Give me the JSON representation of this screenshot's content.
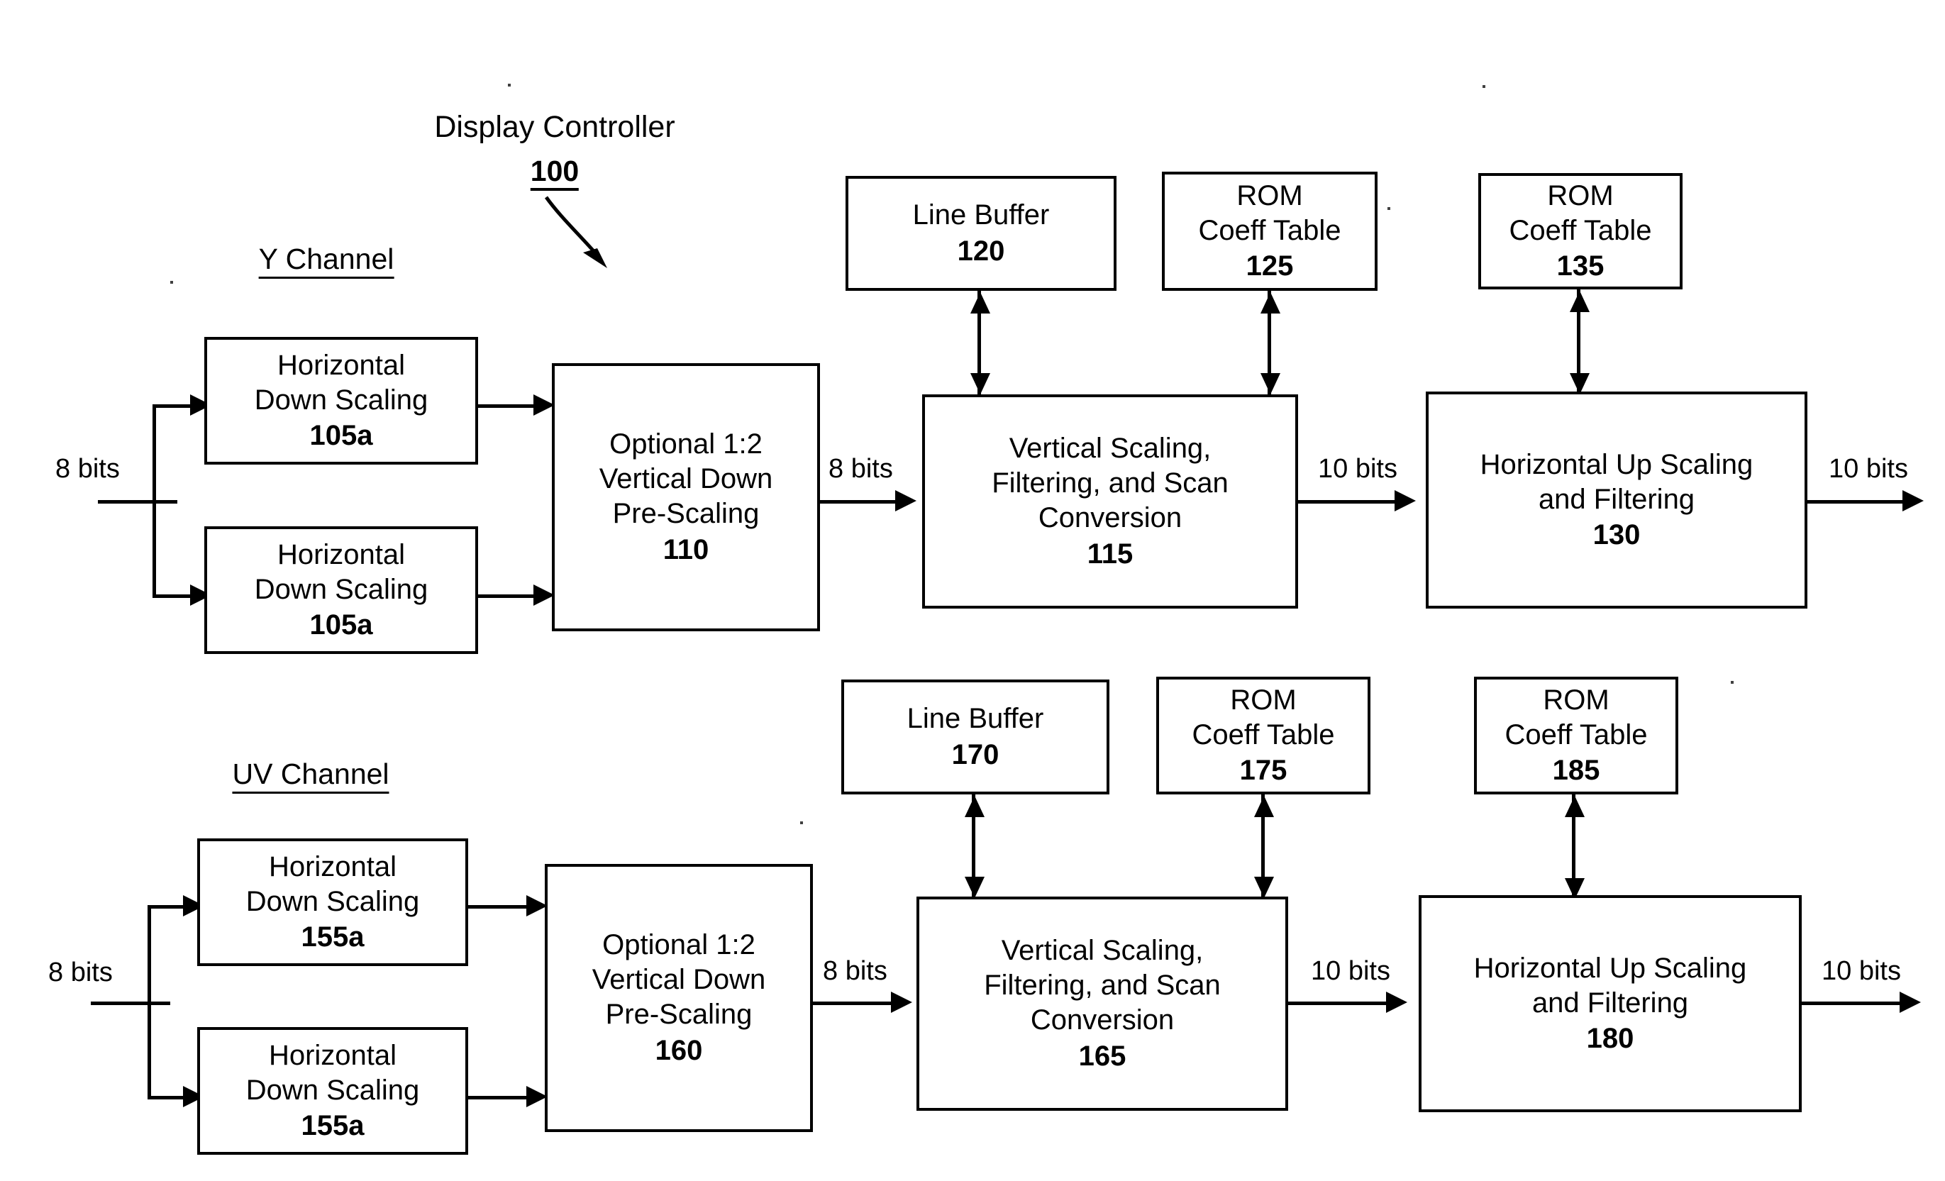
{
  "figure": {
    "title": "Display Controller",
    "title_ref": "100",
    "channels": [
      {
        "label": "Y Channel"
      },
      {
        "label": "UV Channel"
      }
    ]
  },
  "signals": {
    "input_bits": "8 bits",
    "mid_bits": "8 bits",
    "scaled_bits": "10 bits",
    "output_bits": "10 bits"
  },
  "y_channel": {
    "hds_top": {
      "line1": "Horizontal",
      "line2": "Down Scaling",
      "ref": "105a"
    },
    "hds_bottom": {
      "line1": "Horizontal",
      "line2": "Down Scaling",
      "ref": "105a"
    },
    "prescale": {
      "line1": "Optional 1:2",
      "line2": "Vertical Down",
      "line3": "Pre-Scaling",
      "ref": "110"
    },
    "line_buffer": {
      "line1": "Line Buffer",
      "ref": "120"
    },
    "rom_vertical": {
      "line1": "ROM",
      "line2": "Coeff Table",
      "ref": "125"
    },
    "vertical_scaling": {
      "line1": "Vertical Scaling,",
      "line2": "Filtering, and Scan",
      "line3": "Conversion",
      "ref": "115"
    },
    "rom_horizontal": {
      "line1": "ROM",
      "line2": "Coeff Table",
      "ref": "135"
    },
    "upscaling": {
      "line1": "Horizontal Up Scaling",
      "line2": "and Filtering",
      "ref": "130"
    },
    "in_label": "8 bits",
    "mid_label": "8 bits",
    "scaled_label": "10 bits",
    "out_label": "10 bits"
  },
  "uv_channel": {
    "hds_top": {
      "line1": "Horizontal",
      "line2": "Down Scaling",
      "ref": "155a"
    },
    "hds_bottom": {
      "line1": "Horizontal",
      "line2": "Down Scaling",
      "ref": "155a"
    },
    "prescale": {
      "line1": "Optional 1:2",
      "line2": "Vertical Down",
      "line3": "Pre-Scaling",
      "ref": "160"
    },
    "line_buffer": {
      "line1": "Line Buffer",
      "ref": "170"
    },
    "rom_vertical": {
      "line1": "ROM",
      "line2": "Coeff Table",
      "ref": "175"
    },
    "vertical_scaling": {
      "line1": "Vertical Scaling,",
      "line2": "Filtering, and Scan",
      "line3": "Conversion",
      "ref": "165"
    },
    "rom_horizontal": {
      "line1": "ROM",
      "line2": "Coeff Table",
      "ref": "185"
    },
    "upscaling": {
      "line1": "Horizontal Up Scaling",
      "line2": "and Filtering",
      "ref": "180"
    },
    "in_label": "8 bits",
    "mid_label": "8 bits",
    "scaled_label": "10 bits",
    "out_label": "10 bits"
  },
  "colors": {
    "ink": "#000000",
    "paper": "#ffffff"
  }
}
